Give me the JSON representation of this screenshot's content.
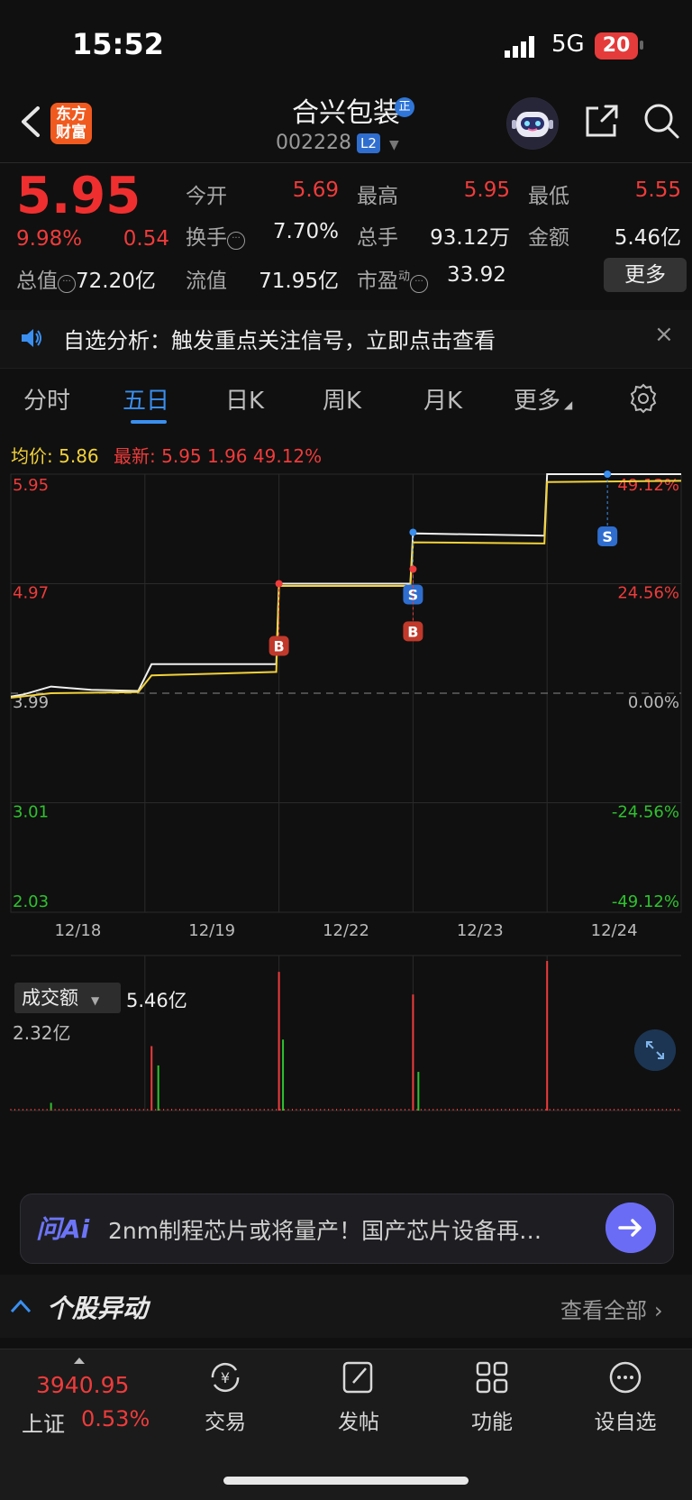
{
  "status_bar": {
    "time": "15:52",
    "network": "5G",
    "battery": "20"
  },
  "header": {
    "brand_logo_text": "东方财富",
    "stock_name": "合兴包装",
    "stock_code": "002228",
    "level_badge": "L2",
    "zheng_badge": "正"
  },
  "quote": {
    "price": "5.95",
    "change_pct": "9.98%",
    "change_amt": "0.54",
    "open_label": "今开",
    "open": "5.69",
    "high_label": "最高",
    "high": "5.95",
    "low_label": "最低",
    "low": "5.55",
    "turnover_rate_label": "换手",
    "turnover_rate": "7.70%",
    "volume_label": "总手",
    "volume": "93.12万",
    "amount_label": "金额",
    "amount": "5.46亿",
    "market_cap_label": "总值",
    "market_cap": "72.20亿",
    "float_cap_label": "流值",
    "float_cap": "71.95亿",
    "pe_label": "市盈",
    "pe_sup": "动",
    "pe": "33.92",
    "more_label": "更多"
  },
  "notice": {
    "text": "自选分析：触发重点关注信号，立即点击查看",
    "close": "×"
  },
  "tabs": [
    {
      "label": "分时"
    },
    {
      "label": "五日"
    },
    {
      "label": "日K"
    },
    {
      "label": "周K"
    },
    {
      "label": "月K"
    },
    {
      "label": "更多"
    }
  ],
  "chart_info": {
    "avg_label": "均价:",
    "avg_value": "5.86",
    "latest_label": "最新:",
    "latest_price": "5.95",
    "latest_change": "1.96",
    "latest_pct": "49.12%"
  },
  "chart_data": {
    "type": "line",
    "title": "",
    "x_ticks": [
      "12/18",
      "12/19",
      "12/22",
      "12/23",
      "12/24"
    ],
    "y_ticks_left": [
      "5.95",
      "4.97",
      "3.99",
      "3.01",
      "2.03"
    ],
    "y_ticks_right": [
      "49.12%",
      "24.56%",
      "0.00%",
      "-24.56%",
      "-49.12%"
    ],
    "ylim": [
      2.03,
      5.95
    ],
    "prev_close": 3.99,
    "series": [
      {
        "name": "最新",
        "color": "#f0f0f0",
        "values": [
          [
            0,
            3.96
          ],
          [
            0.1,
            3.98
          ],
          [
            0.3,
            4.05
          ],
          [
            0.6,
            4.02
          ],
          [
            0.95,
            4.01
          ],
          [
            1.05,
            4.25
          ],
          [
            1.5,
            4.25
          ],
          [
            1.98,
            4.25
          ],
          [
            2.0,
            4.97
          ],
          [
            2.98,
            4.97
          ],
          [
            3.0,
            5.42
          ],
          [
            3.98,
            5.4
          ],
          [
            4.0,
            5.95
          ],
          [
            5.0,
            5.95
          ]
        ]
      },
      {
        "name": "均价",
        "color": "#f2d23a",
        "values": [
          [
            0,
            3.95
          ],
          [
            0.3,
            3.99
          ],
          [
            0.95,
            4.0
          ],
          [
            1.05,
            4.15
          ],
          [
            1.98,
            4.18
          ],
          [
            2.0,
            4.95
          ],
          [
            2.98,
            4.95
          ],
          [
            3.0,
            5.34
          ],
          [
            3.98,
            5.33
          ],
          [
            4.0,
            5.88
          ],
          [
            5.0,
            5.89
          ]
        ]
      }
    ],
    "signals": [
      {
        "label": "B",
        "day": 2.0,
        "price": 4.97
      },
      {
        "label": "S",
        "day": 3.0,
        "price": 5.43
      },
      {
        "label": "B",
        "day": 3.0,
        "price": 5.1
      },
      {
        "label": "S",
        "day": 4.45,
        "price": 5.95
      }
    ],
    "volume": {
      "label": "成交额",
      "total": "5.46亿",
      "max_label": "2.32亿",
      "ymax": 2.32,
      "spikes": [
        {
          "day": 0.3,
          "value": 0.12,
          "color": "green"
        },
        {
          "day": 1.05,
          "value": 1.0,
          "color": "red"
        },
        {
          "day": 1.1,
          "value": 0.7,
          "color": "green"
        },
        {
          "day": 2.0,
          "value": 2.15,
          "color": "red"
        },
        {
          "day": 2.03,
          "value": 1.1,
          "color": "green"
        },
        {
          "day": 3.0,
          "value": 1.8,
          "color": "red"
        },
        {
          "day": 3.04,
          "value": 0.6,
          "color": "green"
        },
        {
          "day": 4.0,
          "value": 2.32,
          "color": "red"
        }
      ]
    }
  },
  "ai_bar": {
    "logo": "问Ai",
    "text": "2nm制程芯片或将量产！国产芯片设备再…"
  },
  "moves": {
    "title": "个股异动",
    "view_all": "查看全部"
  },
  "bottom_nav": {
    "index_value": "3940.95",
    "index_name": "上证",
    "index_pct": "0.53%",
    "items": [
      {
        "label": "交易"
      },
      {
        "label": "发帖"
      },
      {
        "label": "功能"
      },
      {
        "label": "设自选"
      }
    ]
  }
}
